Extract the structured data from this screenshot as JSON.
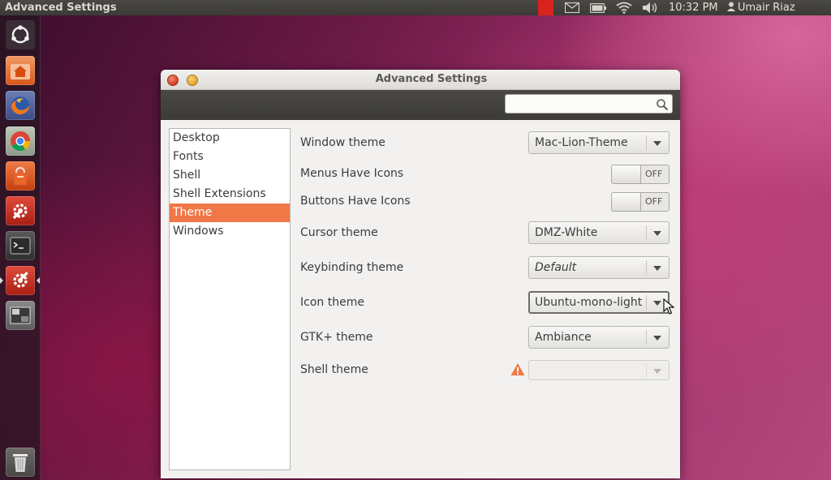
{
  "top_panel": {
    "app_title": "Advanced Settings",
    "time": "10:32 PM",
    "user": "Umair Riaz",
    "indicators": [
      "notification-icon",
      "mail-icon",
      "battery-icon",
      "wifi-icon",
      "volume-icon"
    ]
  },
  "launcher": {
    "items": [
      "ubuntu-home-icon",
      "home-folder-icon",
      "firefox-icon",
      "chrome-icon",
      "software-center-icon",
      "system-settings-icon",
      "terminal-icon",
      "advanced-settings-icon",
      "workspace-switcher-icon",
      "trash-icon"
    ]
  },
  "window": {
    "title": "Advanced Settings",
    "search": {
      "placeholder": "",
      "value": ""
    },
    "sidebar": {
      "items": [
        {
          "label": "Desktop"
        },
        {
          "label": "Fonts"
        },
        {
          "label": "Shell"
        },
        {
          "label": "Shell Extensions"
        },
        {
          "label": "Theme",
          "selected": true
        },
        {
          "label": "Windows"
        }
      ]
    },
    "settings": {
      "window_theme": {
        "label": "Window theme",
        "value": "Mac-Lion-Theme"
      },
      "menus_have_icons": {
        "label": "Menus Have Icons",
        "state": "OFF"
      },
      "buttons_have_icons": {
        "label": "Buttons Have Icons",
        "state": "OFF"
      },
      "cursor_theme": {
        "label": "Cursor theme",
        "value": "DMZ-White"
      },
      "keybinding_theme": {
        "label": "Keybinding theme",
        "value": "Default"
      },
      "icon_theme": {
        "label": "Icon theme",
        "value": "Ubuntu-mono-light"
      },
      "gtk_theme": {
        "label": "GTK+ theme",
        "value": "Ambiance"
      },
      "shell_theme": {
        "label": "Shell theme",
        "value": ""
      }
    }
  },
  "colors": {
    "selection": "#f07746",
    "panel": "#3c3b37",
    "window_bg": "#f2f1f0"
  }
}
